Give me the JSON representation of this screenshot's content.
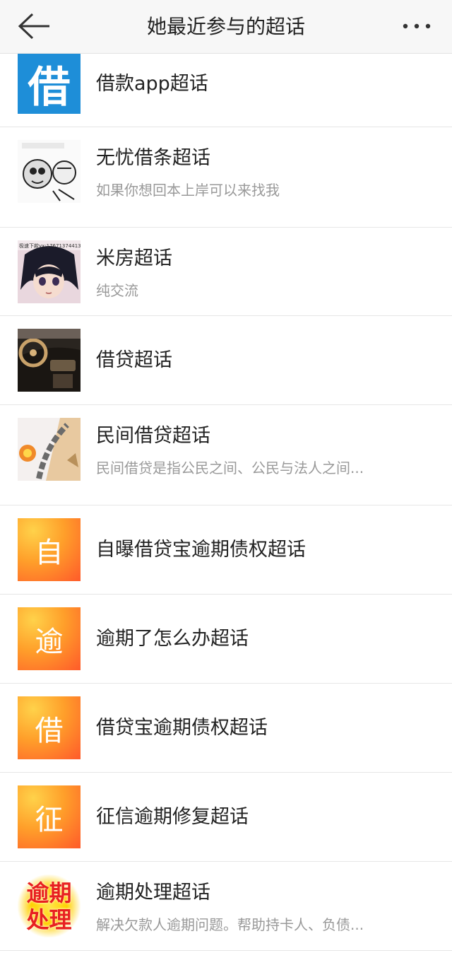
{
  "header": {
    "title": "她最近参与的超话",
    "back_icon": "back-arrow-icon",
    "more_icon": "more-dots-icon"
  },
  "topics": [
    {
      "name": "借款app超话",
      "desc": "",
      "avatar_text": "借",
      "avatar_style": "blue"
    },
    {
      "name": "无忧借条超话",
      "desc": "如果你想回本上岸可以来找我",
      "avatar_style": "comic"
    },
    {
      "name": "米房超话",
      "desc": "纯交流",
      "avatar_style": "anime",
      "avatar_caption": "极速下款vx:17671374413"
    },
    {
      "name": "借贷超话",
      "desc": "",
      "avatar_style": "car"
    },
    {
      "name": "民间借贷超话",
      "desc": "民间借贷是指公民之间、公民与法人之间...",
      "avatar_style": "chain"
    },
    {
      "name": "自曝借贷宝逾期债权超话",
      "desc": "",
      "avatar_text": "自",
      "avatar_style": "orange"
    },
    {
      "name": "逾期了怎么办超话",
      "desc": "",
      "avatar_text": "逾",
      "avatar_style": "orange"
    },
    {
      "name": "借贷宝逾期债权超话",
      "desc": "",
      "avatar_text": "借",
      "avatar_style": "orange"
    },
    {
      "name": "征信逾期修复超话",
      "desc": "",
      "avatar_text": "征",
      "avatar_style": "orange"
    },
    {
      "name": "逾期处理超话",
      "desc": "解决欠款人逾期问题。帮助持卡人、负债...",
      "avatar_style": "text",
      "avatar_line1": "逾期",
      "avatar_line2": "处理"
    }
  ]
}
